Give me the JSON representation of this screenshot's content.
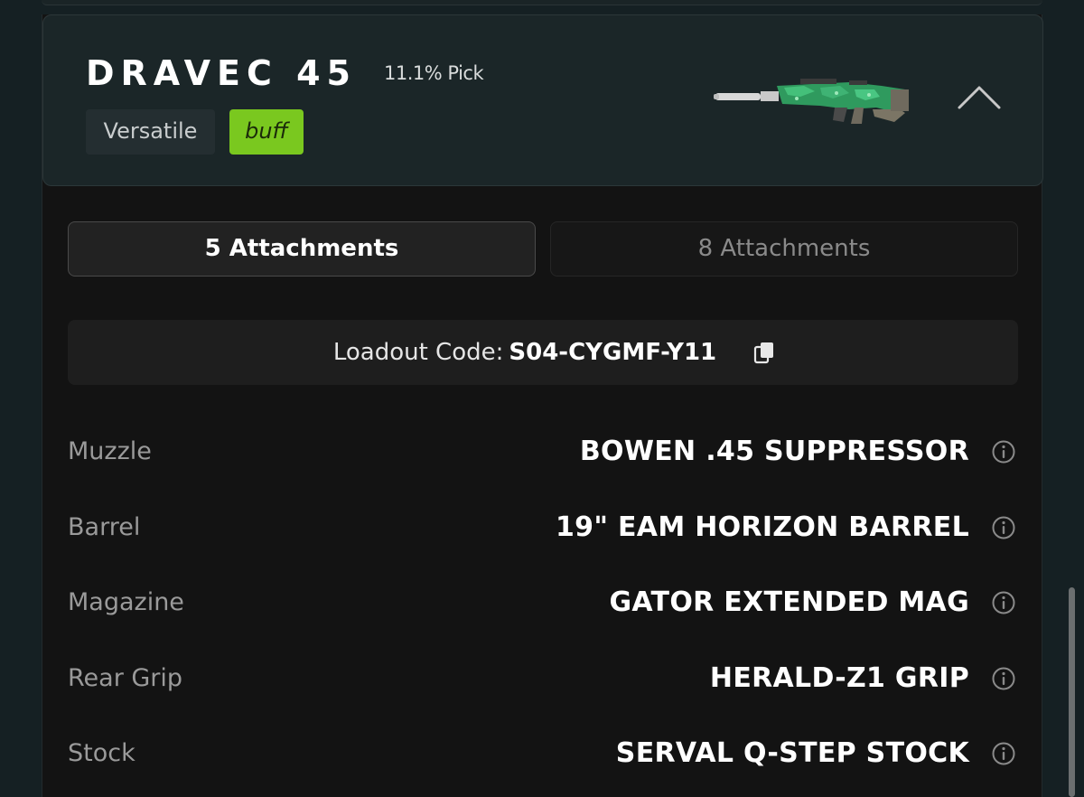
{
  "weapon": {
    "name": "DRAVEC 45",
    "pick_rate": "11.1% Pick",
    "tags": [
      "Versatile",
      "buff"
    ]
  },
  "tabs": [
    {
      "label": "5 Attachments",
      "active": true
    },
    {
      "label": "8 Attachments",
      "active": false
    }
  ],
  "loadout": {
    "label": "Loadout Code:",
    "code": "S04-CYGMF-Y11"
  },
  "attachments": [
    {
      "slot": "Muzzle",
      "name": "BOWEN .45 SUPPRESSOR"
    },
    {
      "slot": "Barrel",
      "name": "19\" EAM HORIZON BARREL"
    },
    {
      "slot": "Magazine",
      "name": "GATOR EXTENDED MAG"
    },
    {
      "slot": "Rear Grip",
      "name": "HERALD-Z1 GRIP"
    },
    {
      "slot": "Stock",
      "name": "SERVAL Q-STEP STOCK"
    }
  ],
  "colors": {
    "buff_tag": "#7ac81f",
    "header_bg": "#1b2628",
    "page_bg": "#152023",
    "card_bg": "#131313"
  },
  "icons": {
    "collapse": "chevron-up-icon",
    "copy": "copy-icon",
    "info": "info-icon"
  }
}
